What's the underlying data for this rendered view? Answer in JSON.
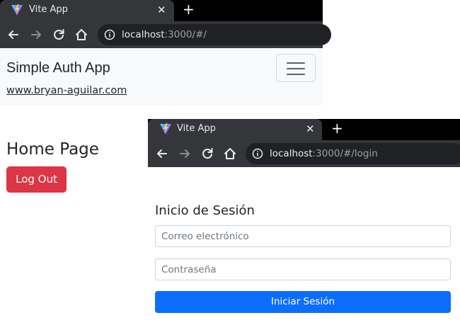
{
  "home_window": {
    "tab": {
      "title": "Vite App",
      "close_glyph": "✕"
    },
    "new_tab_glyph": "+",
    "address": {
      "host": "localhost",
      "path": ":3000/#/"
    },
    "navbar": {
      "brand": "Simple Auth App",
      "link": "www.bryan-aguilar.com"
    },
    "page": {
      "title": "Home Page",
      "logout_label": "Log Out"
    }
  },
  "login_window": {
    "tab": {
      "title": "Vite App",
      "close_glyph": "✕"
    },
    "new_tab_glyph": "+",
    "address": {
      "host": "localhost",
      "path": ":3000/#/login"
    },
    "form": {
      "title": "Inicio de Sesión",
      "email_placeholder": "Correo electrónico",
      "password_placeholder": "Contraseña",
      "submit_label": "Iniciar Sesión"
    }
  },
  "icons": {
    "favicon": "vite-logo-icon",
    "back": "arrow-left-icon",
    "forward": "arrow-right-icon",
    "reload": "reload-icon",
    "home": "home-icon",
    "info": "info-circle-icon",
    "menu": "hamburger-icon"
  },
  "colors": {
    "danger": "#dc3545",
    "primary": "#0d6efd",
    "navbar_bg": "#f8f9fa",
    "chrome_tab": "#35363a",
    "chrome_strip": "#000000",
    "omnibox": "#202124"
  }
}
